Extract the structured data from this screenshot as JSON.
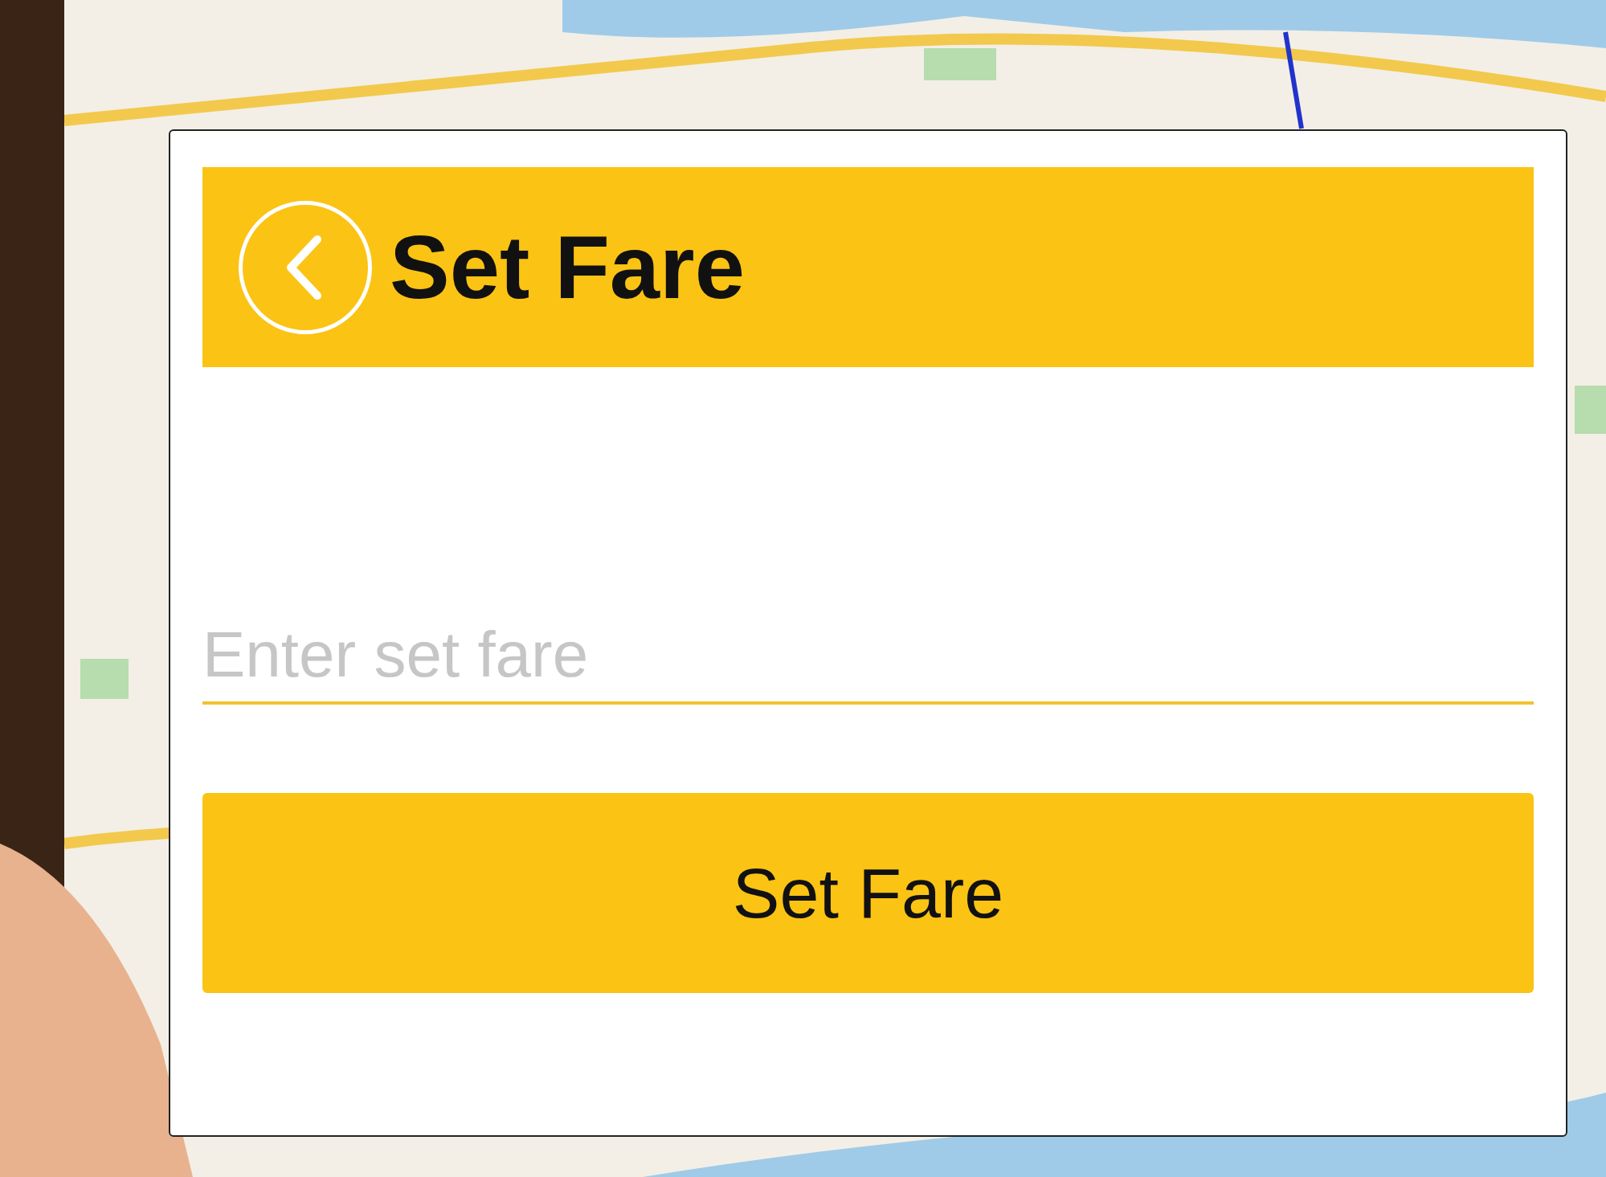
{
  "dialog": {
    "title": "Set Fare",
    "field": {
      "placeholder": "Enter set fare"
    },
    "button": "Set Fare"
  }
}
